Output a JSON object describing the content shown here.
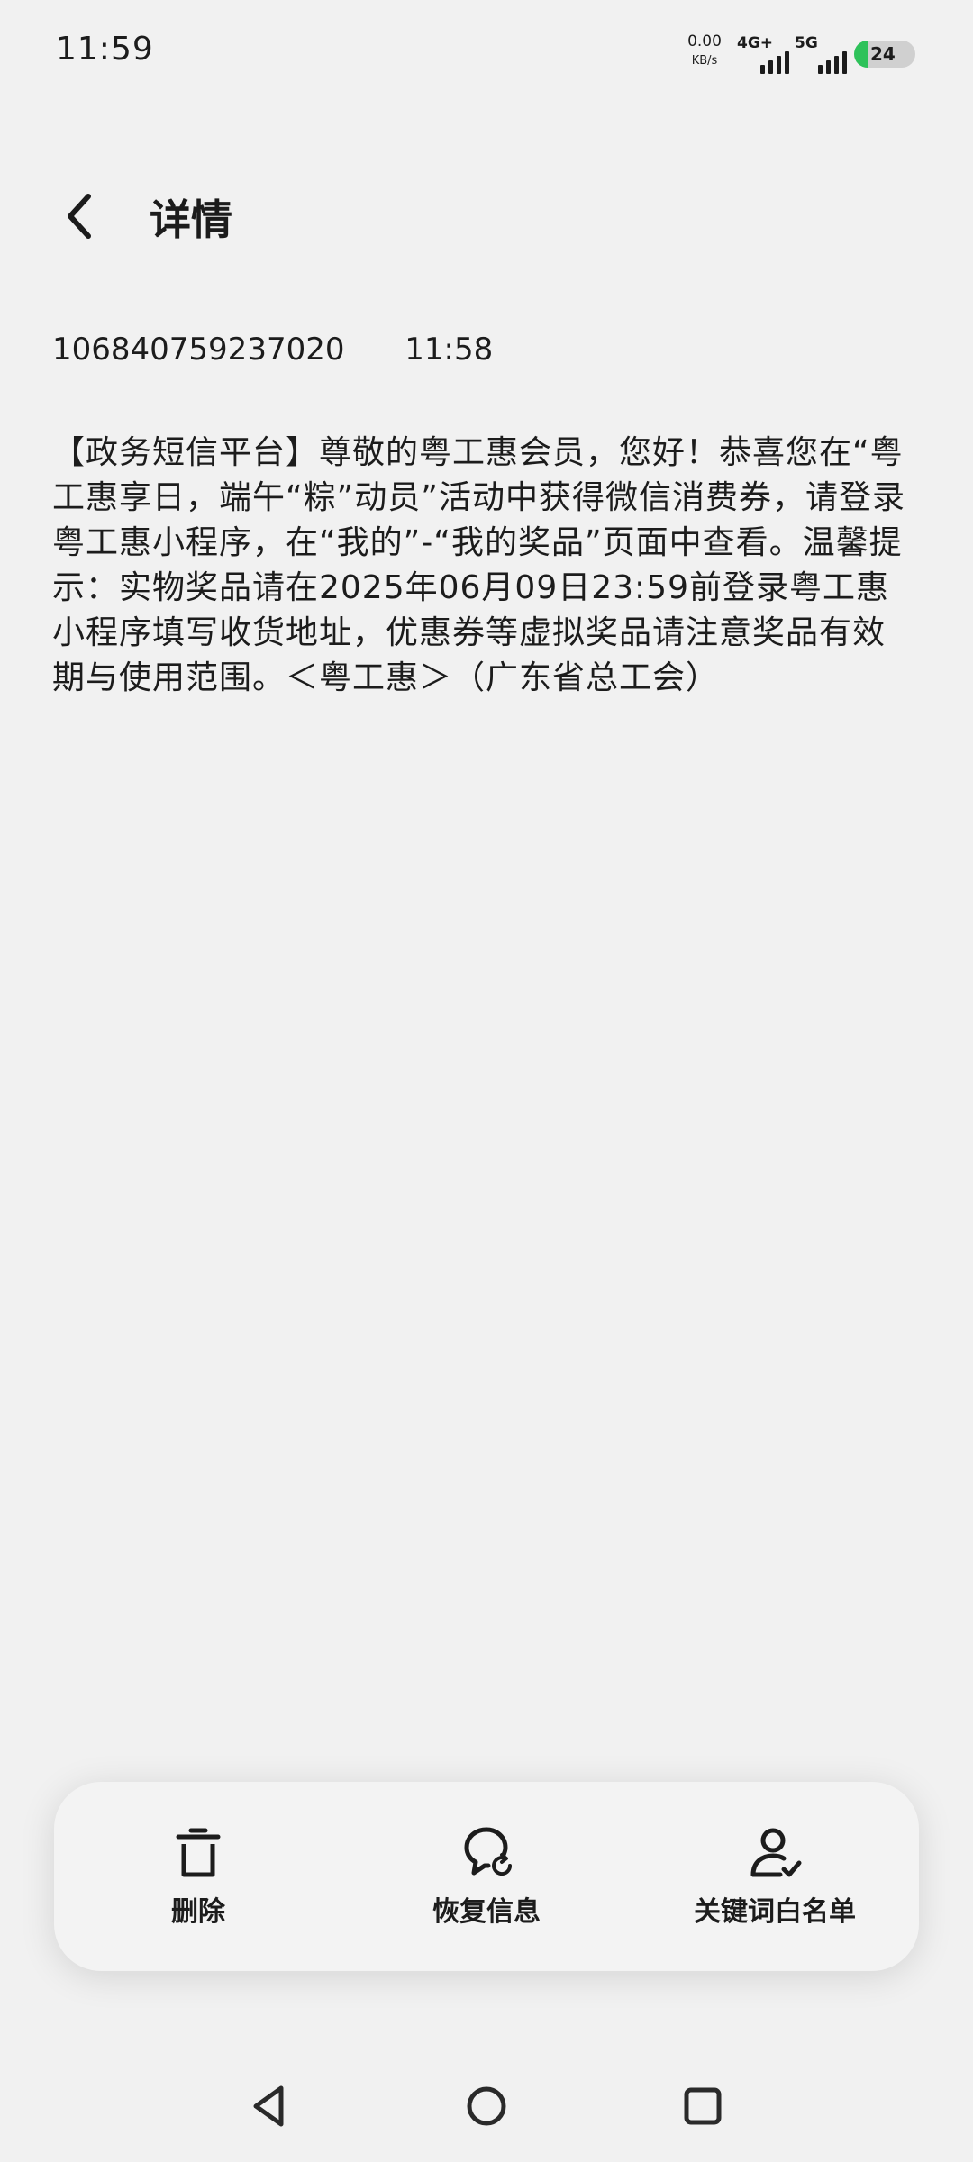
{
  "status_bar": {
    "time": "11:59",
    "net_speed_value": "0.00",
    "net_speed_unit": "KB/s",
    "signal_1_label": "4G+",
    "signal_2_label": "5G",
    "battery_percent": "24",
    "battery_level": 0.24,
    "battery_color": "#2ec25a"
  },
  "header": {
    "back_icon": "chevron-left-icon",
    "title": "详情"
  },
  "message": {
    "sender": "106840759237020",
    "time": "11:58",
    "body": "【政务短信平台】尊敬的粤工惠会员，您好！恭喜您在“粤工惠享日，端午“粽”动员”活动中获得微信消费券，请登录粤工惠小程序，在“我的”-“我的奖品”页面中查看。温馨提示：实物奖品请在2025年06月09日23:59前登录粤工惠小程序填写收货地址，优惠券等虚拟奖品请注意奖品有效期与使用范围。＜粤工惠＞（广东省总工会）"
  },
  "actions": [
    {
      "icon": "trash-icon",
      "label": "删除"
    },
    {
      "icon": "restore-message-icon",
      "label": "恢复信息"
    },
    {
      "icon": "user-check-icon",
      "label": "关键词白名单"
    }
  ],
  "nav_bar": {
    "back_icon": "triangle-back-icon",
    "home_icon": "circle-home-icon",
    "recent_icon": "square-recents-icon"
  }
}
